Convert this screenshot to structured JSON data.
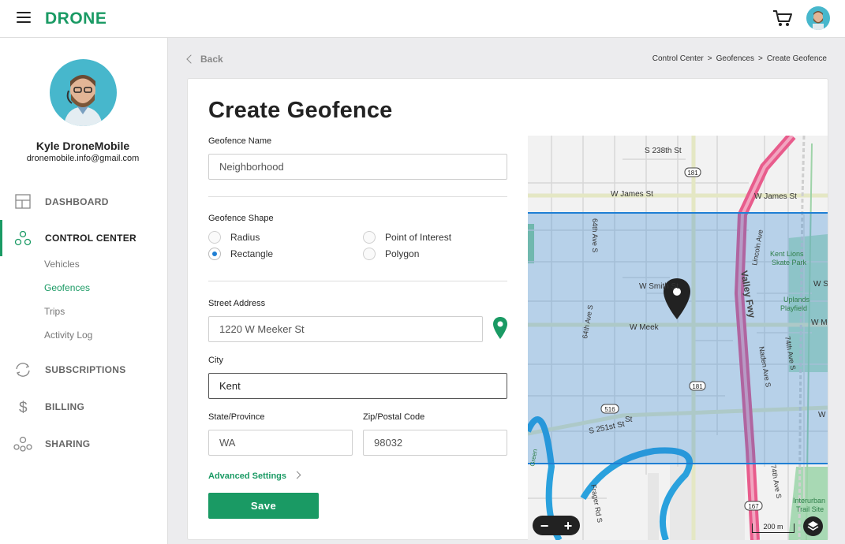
{
  "app": {
    "logo": "DRONE"
  },
  "user": {
    "name": "Kyle DroneMobile",
    "email": "dronemobile.info@gmail.com"
  },
  "sidebar": {
    "items": [
      {
        "label": "DASHBOARD",
        "icon": "dashboard-icon"
      },
      {
        "label": "CONTROL CENTER",
        "icon": "control-center-icon"
      },
      {
        "label": "SUBSCRIPTIONS",
        "icon": "subscriptions-icon"
      },
      {
        "label": "BILLING",
        "icon": "dollar-icon"
      },
      {
        "label": "SHARING",
        "icon": "sharing-icon"
      }
    ],
    "subitems": [
      "Vehicles",
      "Geofences",
      "Trips",
      "Activity Log"
    ],
    "active_subitem": "Geofences"
  },
  "header": {
    "back_label": "Back",
    "breadcrumb": [
      "Control Center",
      "Geofences",
      "Create Geofence"
    ],
    "breadcrumb_sep": ">"
  },
  "form": {
    "title": "Create Geofence",
    "name_label": "Geofence Name",
    "name_value": "Neighborhood",
    "shape_label": "Geofence Shape",
    "shapes": [
      "Radius",
      "Point of Interest",
      "Rectangle",
      "Polygon"
    ],
    "selected_shape": "Rectangle",
    "street_label": "Street Address",
    "street_value": "1220 W Meeker St",
    "city_label": "City",
    "city_value": "Kent",
    "state_label": "State/Province",
    "state_value": "WA",
    "zip_label": "Zip/Postal Code",
    "zip_value": "98032",
    "advanced_label": "Advanced Settings",
    "save_label": "Save"
  },
  "map": {
    "labels": {
      "s238": "S 238th St",
      "wjames1": "W James St",
      "wjames2": "W James St",
      "lincoln": "Lincoln Ave",
      "kentlions1": "Kent Lions",
      "kentlions2": "Skate Park",
      "ave64a": "64th Ave S",
      "wsmith": "W Smith St",
      "ws": "W S",
      "valley": "Valley Fwy",
      "upl1": "Uplands",
      "upl2": "Playfield",
      "wmeek": "W Meek",
      "wme": "W Me",
      "naden": "Naden Ave S",
      "ave64b": "64th Ave S",
      "ave74a": "74th Ave S",
      "s251": "S 251st St",
      "st": "St",
      "frager": "Frager Rd S",
      "ave74b": "74th Ave S",
      "inter1": "Interurban",
      "inter2": "Trail Site",
      "green": "Green",
      "w": "W",
      "r181a": "181",
      "r181b": "181",
      "r516": "516",
      "r167": "167"
    },
    "scale_label": "200 m",
    "zoom_out": "−",
    "zoom_in": "+",
    "colors": {
      "rectangle": "#1f7fd4",
      "freeway": "#e85c8c",
      "river": "#2aa1dd",
      "park": "#8fcfa0"
    }
  },
  "colors": {
    "brand": "#1a9a64",
    "accent": "#1f7fd4"
  }
}
